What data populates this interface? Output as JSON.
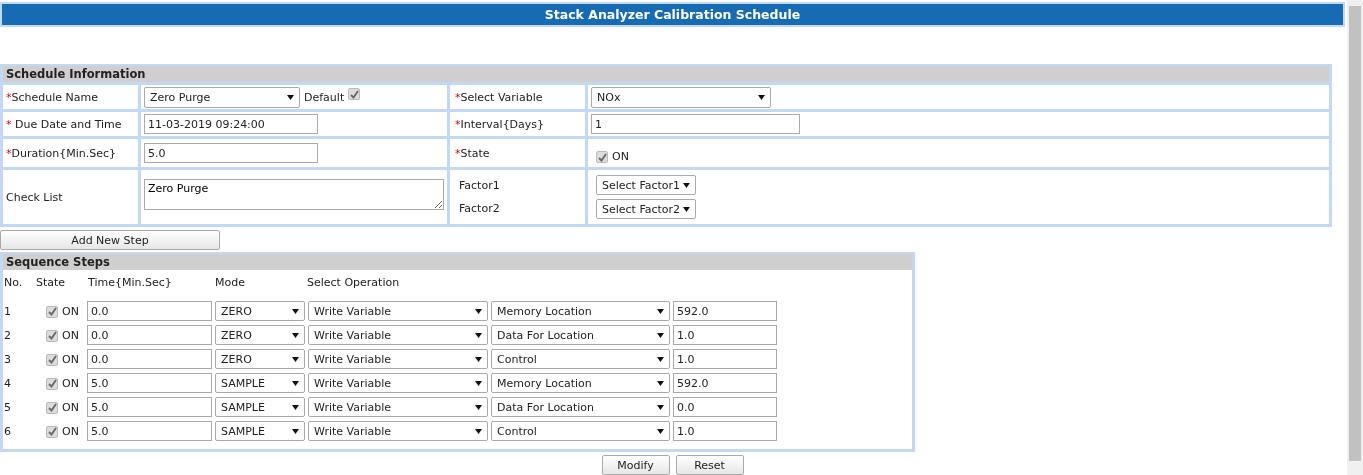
{
  "title": "Stack Analyzer Calibration Schedule",
  "schedule": {
    "title": "Schedule Information",
    "rows": [
      {
        "cells": [
          {
            "kind": "label",
            "mark": "*",
            "text": "Schedule Name"
          },
          {
            "kind": "select",
            "value": "Zero Purge",
            "note": "Default",
            "checked": true
          },
          {
            "kind": "label",
            "mark": "*",
            "text": "Select Variable"
          },
          {
            "kind": "select",
            "value": "NOx"
          }
        ]
      },
      {
        "cells": [
          {
            "kind": "label",
            "mark": "* ",
            "text": "Due Date and Time"
          },
          {
            "kind": "input",
            "value": "11-03-2019 09:24:00"
          },
          {
            "kind": "label",
            "mark": "*",
            "text": "Interval{Days}"
          },
          {
            "kind": "input",
            "value": "1"
          }
        ]
      },
      {
        "cells": [
          {
            "kind": "label",
            "mark": "*",
            "text": "Duration{Min.Sec}"
          },
          {
            "kind": "input",
            "value": "5.0"
          },
          {
            "kind": "label",
            "mark": "*",
            "text": "State"
          },
          {
            "kind": "checkbox",
            "checked": true,
            "text": "ON"
          }
        ]
      },
      {
        "cells": [
          {
            "kind": "label",
            "text": "Check List"
          },
          {
            "kind": "textarea",
            "value": "Zero Purge"
          },
          {
            "kind": "labels",
            "texts": [
              "Factor1",
              "Factor2"
            ]
          },
          {
            "kind": "selects",
            "values": [
              "Select Factor1",
              "Select Factor2"
            ]
          }
        ]
      }
    ]
  },
  "add_button": "Add New Step",
  "steps": {
    "title": "Sequence Steps",
    "columns": [
      "No.",
      "State",
      "Time{Min.Sec}",
      "Mode",
      "Select Operation"
    ],
    "rows": [
      {
        "no": "1",
        "checked": true,
        "state": "ON",
        "time": "0.0",
        "mode": "ZERO",
        "operation": "Write Variable",
        "target": "Memory Location",
        "value": "592.0"
      },
      {
        "no": "2",
        "checked": true,
        "state": "ON",
        "time": "0.0",
        "mode": "ZERO",
        "operation": "Write Variable",
        "target": "Data For Location",
        "value": "1.0"
      },
      {
        "no": "3",
        "checked": true,
        "state": "ON",
        "time": "0.0",
        "mode": "ZERO",
        "operation": "Write Variable",
        "target": "Control",
        "value": "1.0"
      },
      {
        "no": "4",
        "checked": true,
        "state": "ON",
        "time": "5.0",
        "mode": "SAMPLE",
        "operation": "Write Variable",
        "target": "Memory Location",
        "value": "592.0"
      },
      {
        "no": "5",
        "checked": true,
        "state": "ON",
        "time": "5.0",
        "mode": "SAMPLE",
        "operation": "Write Variable",
        "target": "Data For Location",
        "value": "0.0"
      },
      {
        "no": "6",
        "checked": true,
        "state": "ON",
        "time": "5.0",
        "mode": "SAMPLE",
        "operation": "Write Variable",
        "target": "Control",
        "value": "1.0"
      }
    ]
  },
  "buttons": [
    "Modify",
    "Reset"
  ]
}
